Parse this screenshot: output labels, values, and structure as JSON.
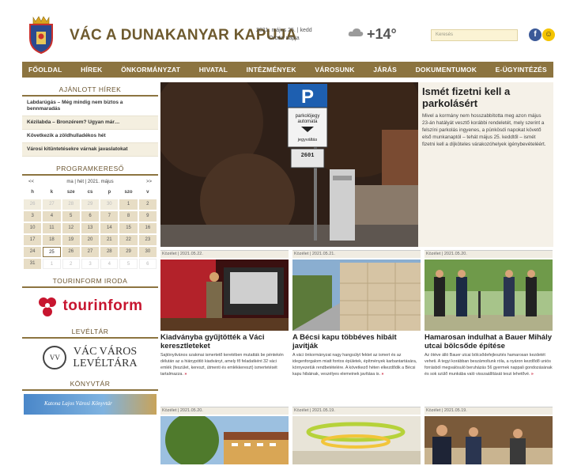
{
  "header": {
    "title": "VÁC A DUNAKANYAR KAPUJA",
    "date_line1": "2021. május 25. | kedd",
    "date_line2": "Orbán napja",
    "temperature": "+14",
    "temp_unit": "°",
    "search_placeholder": "Keresés"
  },
  "nav": [
    "FŐOLDAL",
    "HÍREK",
    "ÖNKORMÁNYZAT",
    "HIVATAL",
    "INTÉZMÉNYEK",
    "VÁROSUNK",
    "JÁRÁS",
    "DOKUMENTUMOK",
    "E-ÜGYINTÉZÉS"
  ],
  "sidebar": {
    "recommended_heading": "AJÁNLOTT HÍREK",
    "recommended": [
      "Labdarúgás – Még mindig nem biztos a bennmaradás",
      "Kézilabda – Bronzérem? Ugyan már…",
      "Következik a zöldhulladékos hét",
      "Városi kitüntetésekre várnak javaslatokat"
    ],
    "program_heading": "PROGRAMKERESŐ",
    "cal_prev": "<<",
    "cal_nav": "ma | hét | 2021. május",
    "cal_next": ">>",
    "day_names": [
      "h",
      "k",
      "sze",
      "cs",
      "p",
      "szo",
      "v"
    ],
    "weeks": [
      [
        {
          "d": "26",
          "s": "o"
        },
        {
          "d": "27",
          "s": "o"
        },
        {
          "d": "28",
          "s": "o"
        },
        {
          "d": "29",
          "s": "o"
        },
        {
          "d": "30",
          "s": "o"
        },
        {
          "d": "1",
          "s": "d"
        },
        {
          "d": "2",
          "s": "d"
        }
      ],
      [
        {
          "d": "3",
          "s": "d"
        },
        {
          "d": "4",
          "s": "d"
        },
        {
          "d": "5",
          "s": "d"
        },
        {
          "d": "6",
          "s": "d"
        },
        {
          "d": "7",
          "s": "d"
        },
        {
          "d": "8",
          "s": "d"
        },
        {
          "d": "9",
          "s": "d"
        }
      ],
      [
        {
          "d": "10",
          "s": "d"
        },
        {
          "d": "11",
          "s": "d"
        },
        {
          "d": "12",
          "s": "d"
        },
        {
          "d": "13",
          "s": "d"
        },
        {
          "d": "14",
          "s": "d"
        },
        {
          "d": "15",
          "s": "d"
        },
        {
          "d": "16",
          "s": "d"
        }
      ],
      [
        {
          "d": "17",
          "s": "d"
        },
        {
          "d": "18",
          "s": "d"
        },
        {
          "d": "19",
          "s": "d"
        },
        {
          "d": "20",
          "s": "d"
        },
        {
          "d": "21",
          "s": "d"
        },
        {
          "d": "22",
          "s": "d"
        },
        {
          "d": "23",
          "s": "d"
        }
      ],
      [
        {
          "d": "24",
          "s": "d"
        },
        {
          "d": "25",
          "s": "t"
        },
        {
          "d": "26",
          "s": "d"
        },
        {
          "d": "27",
          "s": "d"
        },
        {
          "d": "28",
          "s": "d"
        },
        {
          "d": "29",
          "s": "d"
        },
        {
          "d": "30",
          "s": "d"
        }
      ],
      [
        {
          "d": "31",
          "s": "d"
        },
        {
          "d": "1",
          "s": "n"
        },
        {
          "d": "2",
          "s": "n"
        },
        {
          "d": "3",
          "s": "n"
        },
        {
          "d": "4",
          "s": "n"
        },
        {
          "d": "5",
          "s": "n"
        },
        {
          "d": "6",
          "s": "n"
        }
      ]
    ],
    "tourinform_heading": "TOURINFORM IRODA",
    "tourinform_text": "tourinform",
    "archive_heading": "LEVÉLTÁR",
    "archive_logo": "VV",
    "archive_line1": "VÁC VÁROS",
    "archive_line2": "LEVÉLTÁRA",
    "library_heading": "KÖNYVTÁR",
    "library_banner": "Katona Lajos Városi Könyvtár"
  },
  "hero": {
    "title": "Ismét fizetni kell a parkolásért",
    "body": "Mivel a kormány nem hosszabbította meg azon május 23-án hatályát vesztő korábbi rendeletét, mely szerint a felszíni parkolás ingyenes, a pünkösdi napokat követő első munkanaptól – tehát május 25. keddtől – ismét fizetni kell a díjköteles várakozóhelyek igénybevételéért.",
    "sign_p": "P",
    "sign_text1": "parkolójegy",
    "sign_text2": "automata",
    "sign_text3": "jegyváltás",
    "sign_num": "2601"
  },
  "cards": [
    {
      "meta": "Közélet | 2021.05.22.",
      "title": "Kiadványba gyűjtötték a Váci keresztleteket",
      "body": "Sajtónyilvános szakmai ismertető keretében mutatták be péntekén délután az a hiánypótló kiadványt, amely fő feladatként 32 váci emlék (feszület, kereszt, útmenti és emlékkereszt) ismertetését tartalmazza.",
      "more": "»"
    },
    {
      "meta": "Közélet | 2021.05.21.",
      "title": "A Bécsi kapu többéves hibáit javítják",
      "body": "A váci önkormányzat nagy hangsúlyt fektet az ismert és az idegenforgalom miatt fontos épületek, építmények karbantartására, környezetük rendbetételére. A következő héten elkezdődik a Bécsi kapu hibáinak, veszélyes elemeinek javítása is.",
      "more": "»"
    },
    {
      "meta": "Közélet | 2021.05.20.",
      "title": "Hamarosan indulhat a Bauer Mihály utcai bölcsőde építése",
      "body": "Az ötéve álló Bauer utcai bölcsődefejlesztés hamarosan kezdetét veheti. A tegyi korábban beszámoltunk róla, a nyáron kezdődő uniós forrásból megvalósuló beruházás 56 gyermek nappali gondozásának és sok szülő munkába való visszaállítását teszi lehetővé.",
      "more": "»"
    },
    {
      "meta": "Közélet | 2021.05.20."
    },
    {
      "meta": "Közélet | 2021.05.19."
    },
    {
      "meta": "Közélet | 2021.05.19."
    }
  ]
}
